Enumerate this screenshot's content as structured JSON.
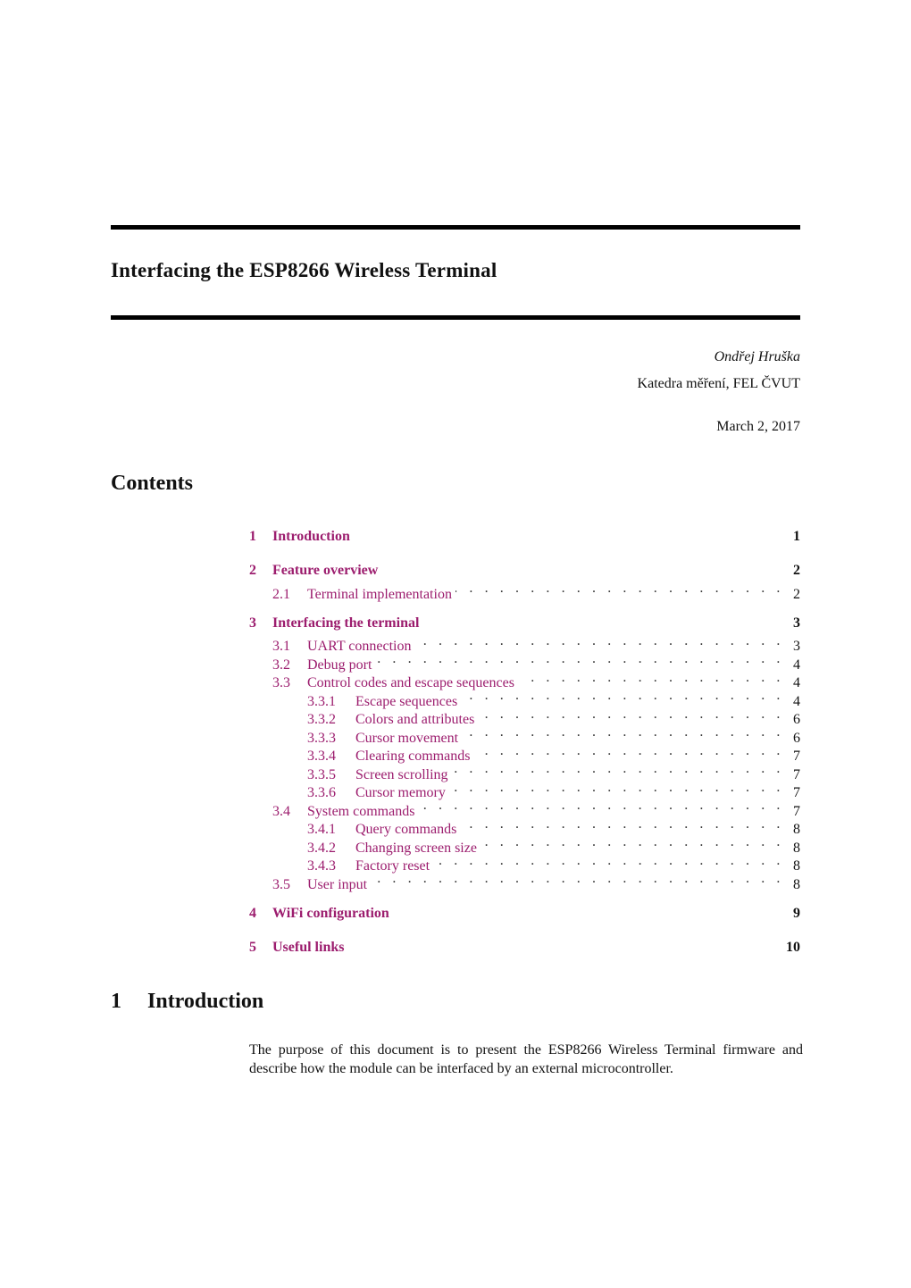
{
  "document": {
    "title": "Interfacing the ESP8266 Wireless Terminal",
    "author": "Ondřej Hruška",
    "affiliation": "Katedra měření, FEL ČVUT",
    "date": "March 2, 2017",
    "link_color": "#9c1d6e"
  },
  "toc": {
    "heading": "Contents",
    "entries": [
      {
        "level": 1,
        "num": "1",
        "title": "Introduction",
        "page": "1"
      },
      {
        "level": 1,
        "num": "2",
        "title": "Feature overview",
        "page": "2"
      },
      {
        "level": 2,
        "num": "2.1",
        "title": "Terminal implementation",
        "page": "2"
      },
      {
        "level": 1,
        "num": "3",
        "title": "Interfacing the terminal",
        "page": "3"
      },
      {
        "level": 2,
        "num": "3.1",
        "title": "UART connection",
        "page": "3"
      },
      {
        "level": 2,
        "num": "3.2",
        "title": "Debug port",
        "page": "4"
      },
      {
        "level": 2,
        "num": "3.3",
        "title": "Control codes and escape sequences",
        "page": "4"
      },
      {
        "level": 3,
        "num": "3.3.1",
        "title": "Escape sequences",
        "page": "4"
      },
      {
        "level": 3,
        "num": "3.3.2",
        "title": "Colors and attributes",
        "page": "6"
      },
      {
        "level": 3,
        "num": "3.3.3",
        "title": "Cursor movement",
        "page": "6"
      },
      {
        "level": 3,
        "num": "3.3.4",
        "title": "Clearing commands",
        "page": "7"
      },
      {
        "level": 3,
        "num": "3.3.5",
        "title": "Screen scrolling",
        "page": "7"
      },
      {
        "level": 3,
        "num": "3.3.6",
        "title": "Cursor memory",
        "page": "7"
      },
      {
        "level": 2,
        "num": "3.4",
        "title": "System commands",
        "page": "7"
      },
      {
        "level": 3,
        "num": "3.4.1",
        "title": "Query commands",
        "page": "8"
      },
      {
        "level": 3,
        "num": "3.4.2",
        "title": "Changing screen size",
        "page": "8"
      },
      {
        "level": 3,
        "num": "3.4.3",
        "title": "Factory reset",
        "page": "8"
      },
      {
        "level": 2,
        "num": "3.5",
        "title": "User input",
        "page": "8"
      },
      {
        "level": 1,
        "num": "4",
        "title": "WiFi configuration",
        "page": "9"
      },
      {
        "level": 1,
        "num": "5",
        "title": "Useful links",
        "page": "10"
      }
    ]
  },
  "introduction": {
    "num": "1",
    "heading": "Introduction",
    "body": "The purpose of this document is to present the ESP8266 Wireless Terminal firmware and describe how the module can be interfaced by an external microcontroller."
  }
}
